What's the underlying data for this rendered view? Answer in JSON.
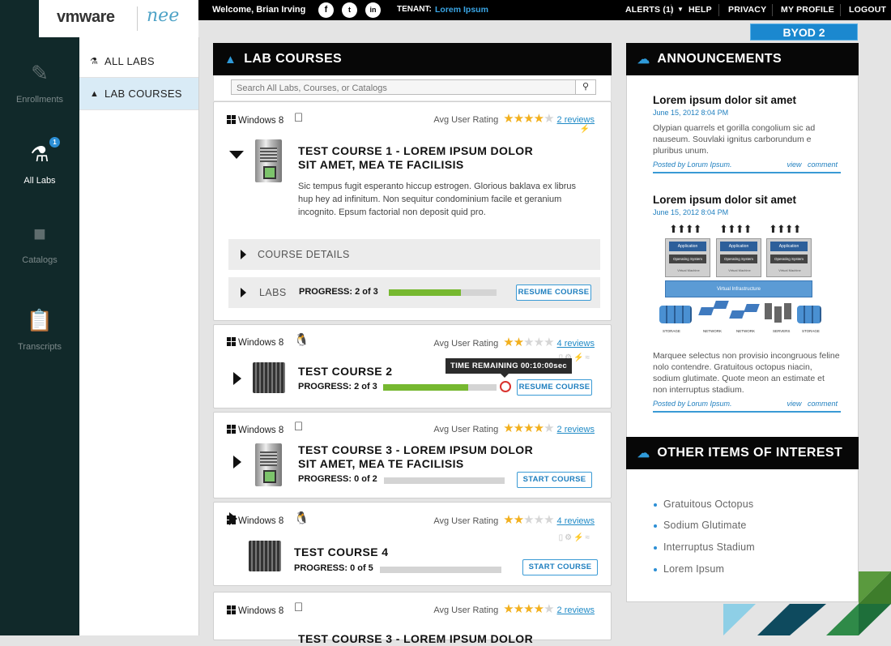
{
  "brand": {
    "logo_text": "vmware",
    "product": "nee"
  },
  "sidebar_rail": {
    "items": [
      {
        "label": "Enrollments",
        "icon": "pencil-icon",
        "active": false
      },
      {
        "label": "All Labs",
        "icon": "flask-icon",
        "active": true,
        "badge": "1"
      },
      {
        "label": "Catalogs",
        "icon": "book-icon",
        "active": false
      },
      {
        "label": "Transcripts",
        "icon": "clipboard-icon",
        "active": false
      }
    ]
  },
  "menu": {
    "items": [
      {
        "label": "ALL LABS",
        "icon": "flask-icon",
        "active": false
      },
      {
        "label": "LAB COURSES",
        "icon": "graduation-cap-icon",
        "active": true
      }
    ]
  },
  "topbar": {
    "welcome": "Welcome, Brian Irving",
    "social": [
      "f",
      "t",
      "in"
    ],
    "tenant_label": "TENANT:",
    "tenant_value": "Lorem Ipsum",
    "alerts": "ALERTS (1)",
    "help": "HELP",
    "privacy": "PRIVACY",
    "my_profile": "MY PROFILE",
    "logout": "LOGOUT"
  },
  "badge_label": "BYOD 2",
  "lab_courses": {
    "title": "LAB COURSES",
    "search_placeholder": "Search All Labs, Courses, or Catalogs",
    "rating_label": "Avg User Rating",
    "courses": [
      {
        "os": "Windows 8",
        "os2_icon": "apple-icon",
        "rating": 4,
        "reviews": "2 reviews",
        "title_line1": "TEST COURSE 1 - LOREM IPSUM DOLOR",
        "title_line2": "SIT AMET, MEA TE FACILISIS",
        "description": "Sic tempus fugit esperanto hiccup estrogen. Glorious baklava ex librus hup hey ad infinitum. Non sequitur condominium facile et geranium incognito. Epsum factorial non deposit quid pro.",
        "details_label": "COURSE DETAILS",
        "labs_label": "LABS",
        "progress": "PROGRESS: 2 of 3",
        "progress_fraction": 0.67,
        "button": "RESUME COURSE"
      },
      {
        "os": "Windows 8",
        "os2_icon": "linux-icon",
        "rating": 2,
        "reviews": "4 reviews",
        "title_line1": "TEST COURSE 2",
        "progress": "PROGRESS: 2 of 3",
        "progress_fraction": 0.75,
        "tooltip": "TIME REMAINING 00:10:00sec",
        "button": "RESUME COURSE"
      },
      {
        "os": "Windows 8",
        "os2_icon": "apple-icon",
        "rating": 4,
        "reviews": "2 reviews",
        "title_line1": "TEST COURSE 3 - LOREM IPSUM DOLOR",
        "title_line2": "SIT AMET, MEA TE FACILISIS",
        "progress": "PROGRESS: 0 of 2",
        "progress_fraction": 0,
        "button": "START COURSE"
      },
      {
        "os": "Windows 8",
        "os2_icon": "linux-icon",
        "rating": 2,
        "reviews": "4 reviews",
        "title_line1": "TEST COURSE 4",
        "progress": "PROGRESS: 0 of 5",
        "progress_fraction": 0,
        "button": "START COURSE"
      },
      {
        "os": "Windows 8",
        "os2_icon": "apple-icon",
        "rating": 4,
        "reviews": "2 reviews",
        "title_line1": "TEST COURSE 3 - LOREM IPSUM DOLOR"
      }
    ]
  },
  "announcements": {
    "title": "ANNOUNCEMENTS",
    "items": [
      {
        "title": "Lorem ipsum dolor sit amet",
        "date": "June 15, 2012 8:04 PM",
        "body": "Olypian quarrels et gorilla congolium sic ad nauseum. Souvlaki ignitus carborundum e pluribus unum.",
        "posted_by": "Posted by Lorum Ipsum.",
        "view": "view",
        "comment": "comment"
      },
      {
        "title": "Lorem ipsum dolor sit amet",
        "date": "June 15, 2012 8:04 PM",
        "body": "Marquee selectus non provisio incongruous feline nolo contendre. Gratuitous octopus niacin, sodium glutimate. Quote meon an estimate et non interruptus stadium.",
        "posted_by": "Posted by Lorum Ipsum.",
        "view": "view",
        "comment": "comment"
      }
    ],
    "diagram": {
      "app_label": "Application",
      "os_label": "Operating System",
      "vm_label": "Virtual Machine",
      "infra_label": "Virtual Infrastructure",
      "bottom_labels": [
        "STORAGE",
        "NETWORK",
        "NETWORK",
        "SERVERS",
        "STORAGE"
      ]
    }
  },
  "other_items": {
    "title": "OTHER ITEMS OF INTEREST",
    "items": [
      "Gratuitous Octopus",
      "Sodium Glutimate",
      "Interruptus Stadium",
      "Lorem Ipsum"
    ]
  },
  "colors": {
    "accent": "#1b88cf",
    "progress": "#76b830",
    "rail": "#11292a",
    "star": "#f2b01e"
  }
}
